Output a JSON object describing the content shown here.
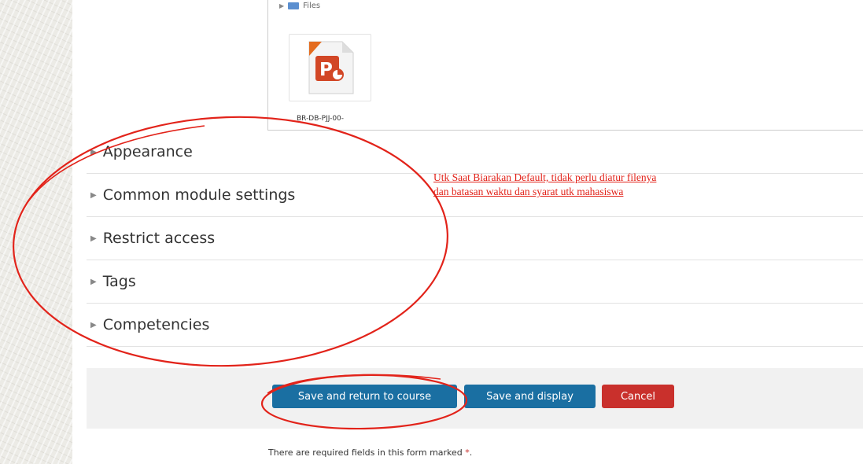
{
  "file_manager": {
    "path_label": "Files",
    "file": {
      "name": "BR-DB-PJJ-00-",
      "icon": "powerpoint-file-icon"
    }
  },
  "sections": [
    {
      "label": "Appearance"
    },
    {
      "label": "Common module settings"
    },
    {
      "label": "Restrict access"
    },
    {
      "label": "Tags"
    },
    {
      "label": "Competencies"
    }
  ],
  "annotation": {
    "line1": "Utk Saat Biarakan Default, tidak perlu diatur filenya",
    "line2": "dan batasan waktu dan syarat utk mahasiswa",
    "color": "#e2231a"
  },
  "buttons": {
    "save_return": "Save and return to course",
    "save_display": "Save and display",
    "cancel": "Cancel"
  },
  "footer": {
    "required_text": "There are required fields in this form marked",
    "required_marker": "*",
    "required_end": "."
  },
  "colors": {
    "primary": "#1a6fa2",
    "danger": "#c9302c"
  }
}
